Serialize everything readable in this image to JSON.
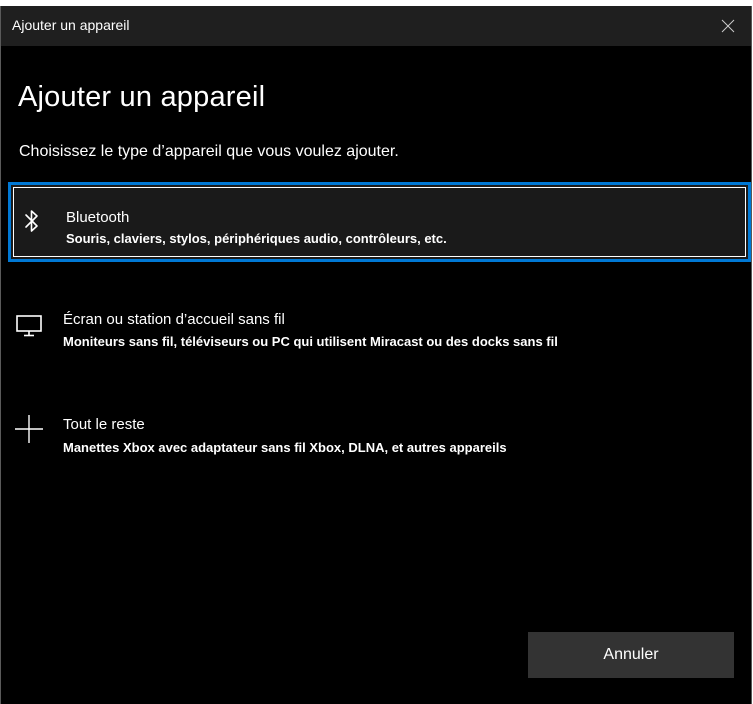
{
  "window": {
    "title": "Ajouter un appareil",
    "close_icon": "close-icon"
  },
  "main": {
    "heading": "Ajouter un appareil",
    "instruction": "Choisissez le type d’appareil que vous voulez ajouter."
  },
  "options": [
    {
      "icon": "bluetooth-icon",
      "title": "Bluetooth",
      "description": "Souris, claviers, stylos, périphériques audio, contrôleurs, etc.",
      "selected": true
    },
    {
      "icon": "monitor-icon",
      "title": "Écran ou station d’accueil sans fil",
      "description": "Moniteurs sans fil, téléviseurs ou PC qui utilisent Miracast ou des docks sans fil",
      "selected": false
    },
    {
      "icon": "plus-icon",
      "title": "Tout le reste",
      "description": "Manettes Xbox avec adaptateur sans fil Xbox, DLNA, et autres appareils",
      "selected": false
    }
  ],
  "footer": {
    "cancel_label": "Annuler"
  },
  "colors": {
    "background": "#000000",
    "titlebar": "#1f1f1f",
    "selection_border": "#0078d4",
    "button": "#333333",
    "text": "#ffffff"
  }
}
